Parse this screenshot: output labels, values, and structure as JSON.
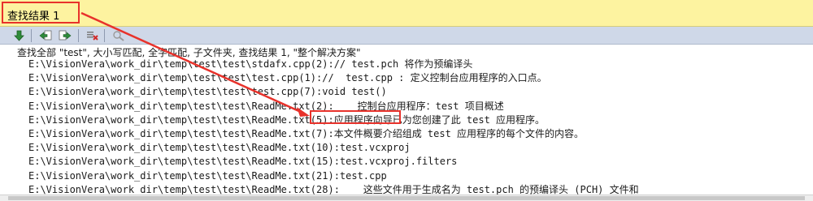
{
  "panel": {
    "title": "查找结果 1"
  },
  "toolbar": {
    "buttons": [
      {
        "icon": "go-to-location-icon"
      },
      {
        "icon": "previous-result-icon"
      },
      {
        "icon": "next-result-icon"
      },
      {
        "icon": "clear-all-icon"
      },
      {
        "icon": "stop-find-icon"
      }
    ]
  },
  "results": {
    "summary": "查找全部 \"test\", 大小写匹配, 全字匹配, 子文件夹, 查找结果 1, \"整个解决方案\"",
    "rows": [
      {
        "path": "E:\\VisionVera\\work_dir\\temp\\test\\test\\stdafx.cpp(2)",
        "content": ":// test.pch 将作为预编译头"
      },
      {
        "path": "E:\\VisionVera\\work_dir\\temp\\test\\test\\test.cpp(1)",
        "content": "://  test.cpp : 定义控制台应用程序的入口点。"
      },
      {
        "path": "E:\\VisionVera\\work_dir\\temp\\test\\test\\test.cpp(7)",
        "content": ":void test()"
      },
      {
        "path": "E:\\VisionVera\\work_dir\\temp\\test\\test\\ReadMe.txt(2)",
        "content": ":    控制台应用程序：test 项目概述"
      },
      {
        "path": "E:\\VisionVera\\work_dir\\temp\\test\\test\\ReadMe.txt(5)",
        "content": ":应用程序向导已为您创建了此 test 应用程序。"
      },
      {
        "path": "E:\\VisionVera\\work_dir\\temp\\test\\test\\ReadMe.txt(7)",
        "content": ":本文件概要介绍组成 test 应用程序的每个文件的内容。"
      },
      {
        "path": "E:\\VisionVera\\work_dir\\temp\\test\\test\\ReadMe.txt(10)",
        "content": ":test.vcxproj"
      },
      {
        "path": "E:\\VisionVera\\work_dir\\temp\\test\\test\\ReadMe.txt(15)",
        "content": ":test.vcxproj.filters"
      },
      {
        "path": "E:\\VisionVera\\work_dir\\temp\\test\\test\\ReadMe.txt(21)",
        "content": ":test.cpp"
      },
      {
        "path": "E:\\VisionVera\\work_dir\\temp\\test\\test\\ReadMe.txt(28)",
        "content": ":    这些文件用于生成名为 test.pch 的预编译头 (PCH) 文件和"
      }
    ]
  },
  "colors": {
    "annotation": "#e8322b",
    "title_bg": "#fdf3a0",
    "toolbar_bg": "#cfd8e8"
  }
}
